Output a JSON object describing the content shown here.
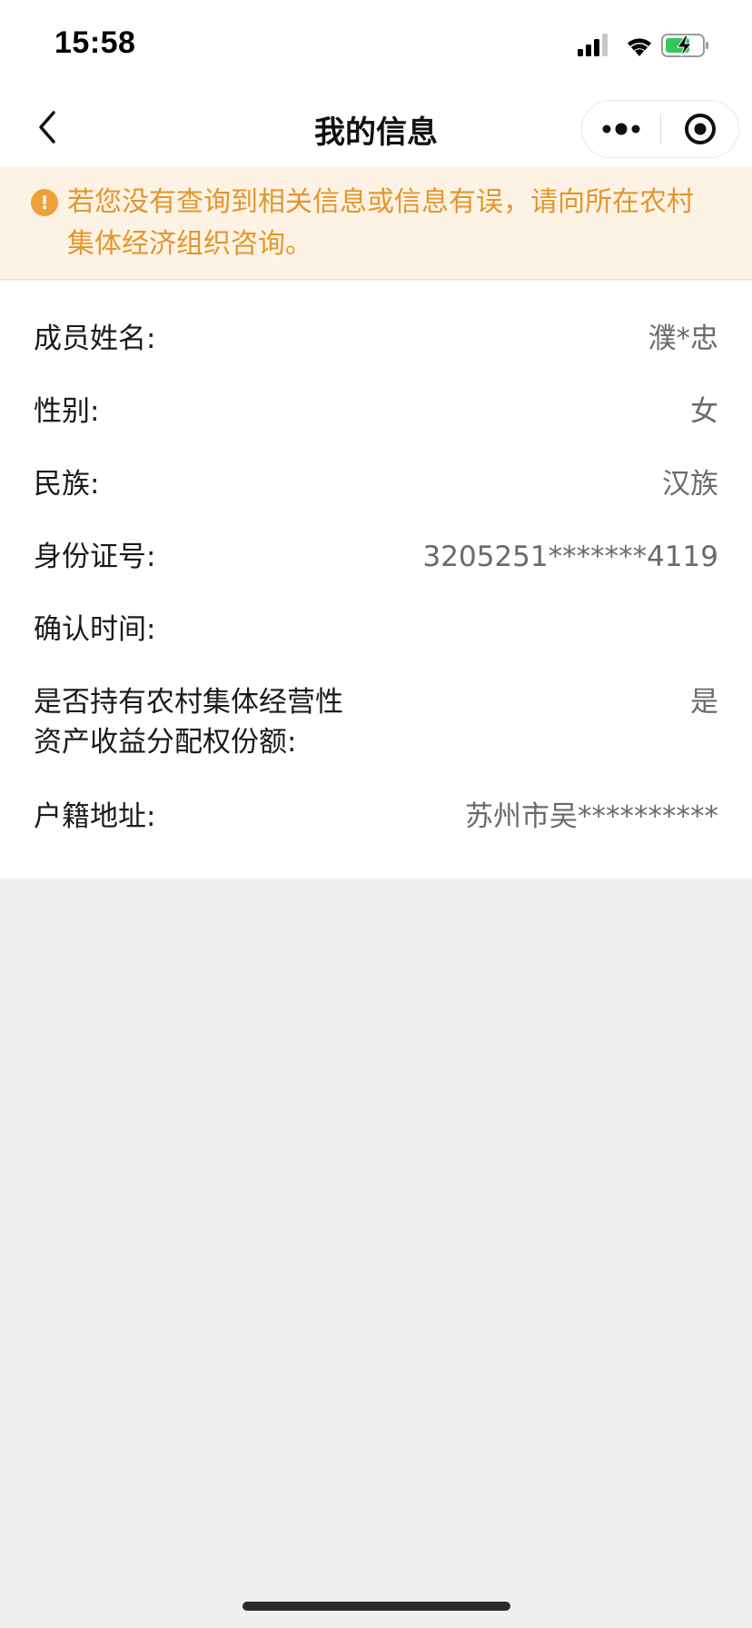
{
  "status_bar": {
    "time": "15:58"
  },
  "nav": {
    "title": "我的信息",
    "back_icon": "chevron-left-icon",
    "more_icon": "more-dots-icon",
    "close_icon": "target-circle-icon"
  },
  "notice": {
    "icon": "exclamation-icon",
    "text": "若您没有查询到相关信息或信息有误，请向所在农村集体经济组织咨询。"
  },
  "info": {
    "rows": [
      {
        "label": "成员姓名:",
        "value": "濮*忠"
      },
      {
        "label": "性别:",
        "value": "女"
      },
      {
        "label": "民族:",
        "value": "汉族"
      },
      {
        "label": "身份证号:",
        "value": "3205251*******4119"
      },
      {
        "label": "确认时间:",
        "value": ""
      },
      {
        "label": "是否持有农村集体经营性\n资产收益分配权份额:",
        "value": "是"
      },
      {
        "label": "户籍地址:",
        "value": "苏州市吴**********"
      }
    ]
  },
  "colors": {
    "notice_background": "#fdf3e4",
    "notice_text": "#e3962e",
    "page_background": "#efeff1"
  }
}
